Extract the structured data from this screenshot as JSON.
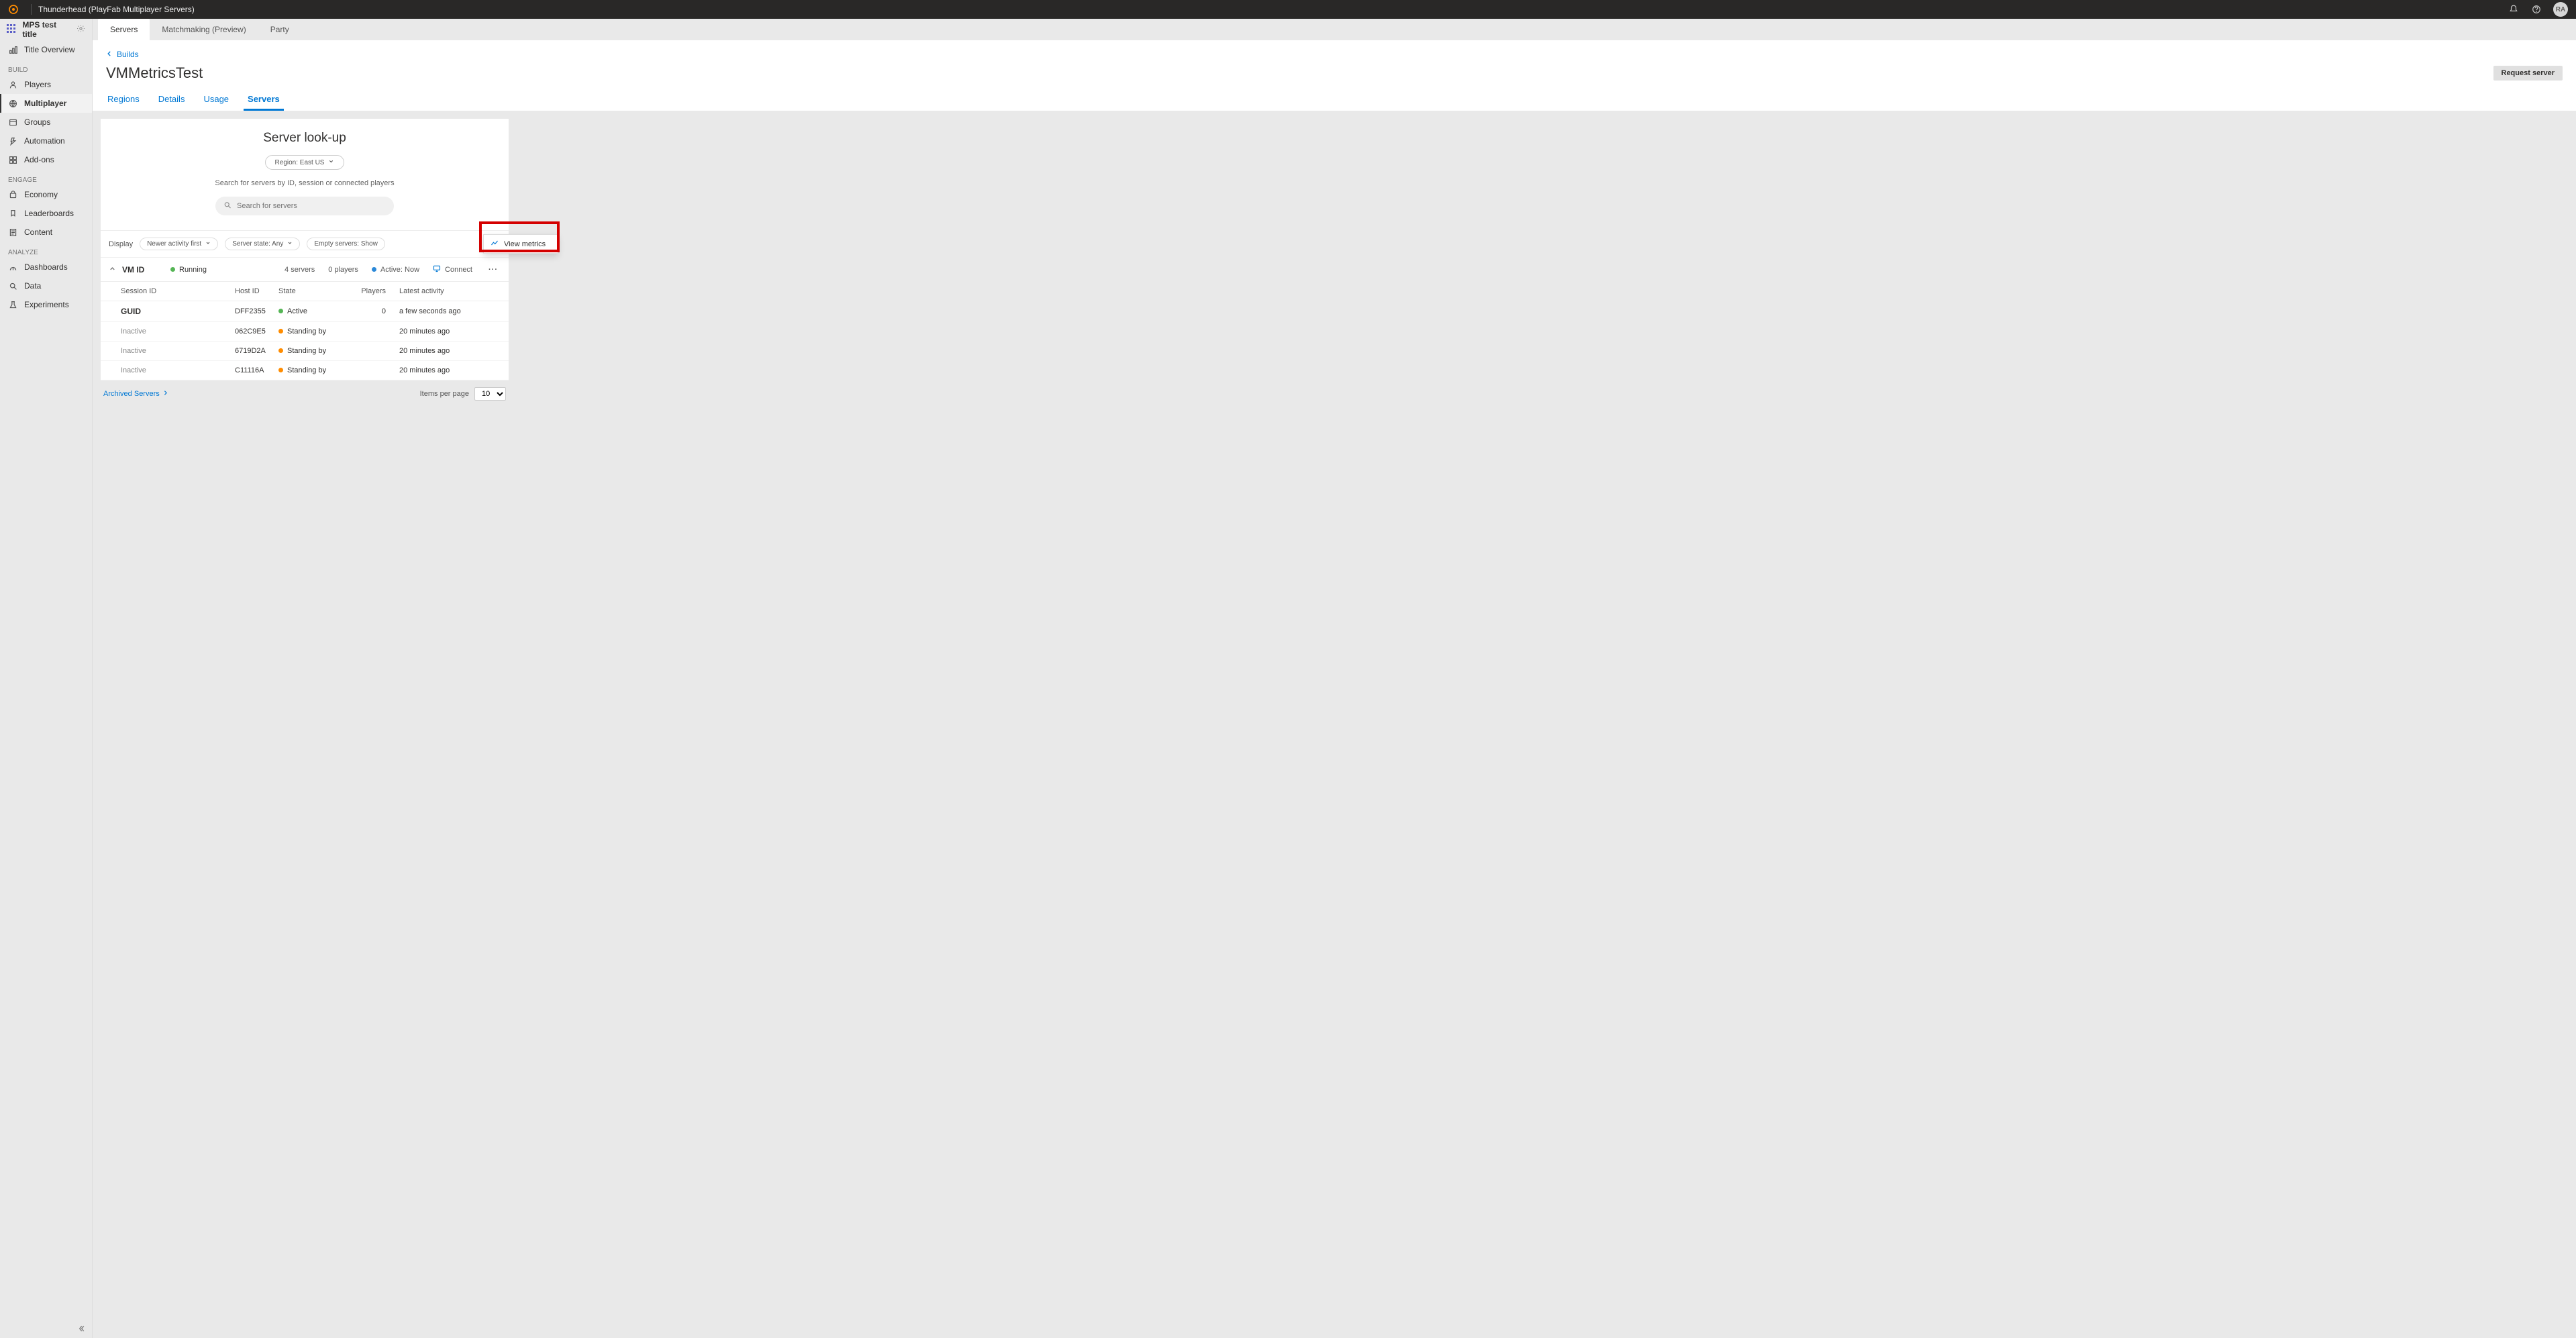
{
  "topbar": {
    "title": "Thunderhead (PlayFab Multiplayer Servers)",
    "avatar_initials": "RA"
  },
  "sidebar": {
    "title": "MPS test title",
    "item_overview": "Title Overview",
    "section_build": "Build",
    "items_build": {
      "players": "Players",
      "multiplayer": "Multiplayer",
      "groups": "Groups",
      "automation": "Automation",
      "addons": "Add-ons"
    },
    "section_engage": "Engage",
    "items_engage": {
      "economy": "Economy",
      "leaderboards": "Leaderboards",
      "content": "Content"
    },
    "section_analyze": "Analyze",
    "items_analyze": {
      "dashboards": "Dashboards",
      "data": "Data",
      "experiments": "Experiments"
    }
  },
  "tabs": {
    "servers": "Servers",
    "matchmaking": "Matchmaking (Preview)",
    "party": "Party"
  },
  "breadcrumb": {
    "back": "Builds"
  },
  "page": {
    "title": "VMMetricsTest",
    "request_btn": "Request server"
  },
  "subtabs": {
    "regions": "Regions",
    "details": "Details",
    "usage": "Usage",
    "servers": "Servers"
  },
  "lookup": {
    "title": "Server look-up",
    "region_label": "Region: East US",
    "hint": "Search for servers by ID, session or connected players",
    "placeholder": "Search for servers"
  },
  "filters": {
    "display_label": "Display",
    "newer": "Newer activity first",
    "state": "Server state: Any",
    "empty": "Empty servers: Show"
  },
  "vm": {
    "id_label": "VM ID",
    "status": "Running",
    "servers_count": "4 servers",
    "players_count": "0 players",
    "active": "Active: Now",
    "connect": "Connect"
  },
  "columns": {
    "session": "Session ID",
    "host": "Host ID",
    "state": "State",
    "players": "Players",
    "activity": "Latest activity"
  },
  "rows": [
    {
      "session": "GUID",
      "host": "DFF2355",
      "state": "Active",
      "dot": "green",
      "players": "0",
      "activity": "a few seconds ago"
    },
    {
      "session": "Inactive",
      "host": "062C9E5",
      "state": "Standing by",
      "dot": "orange",
      "players": "",
      "activity": "20 minutes ago"
    },
    {
      "session": "Inactive",
      "host": "6719D2A",
      "state": "Standing by",
      "dot": "orange",
      "players": "",
      "activity": "20 minutes ago"
    },
    {
      "session": "Inactive",
      "host": "C11116A",
      "state": "Standing by",
      "dot": "orange",
      "players": "",
      "activity": "20 minutes ago"
    }
  ],
  "ctx_menu": {
    "view_metrics": "View metrics"
  },
  "footer": {
    "archived": "Archived Servers",
    "items_label": "Items per page",
    "items_value": "10"
  }
}
